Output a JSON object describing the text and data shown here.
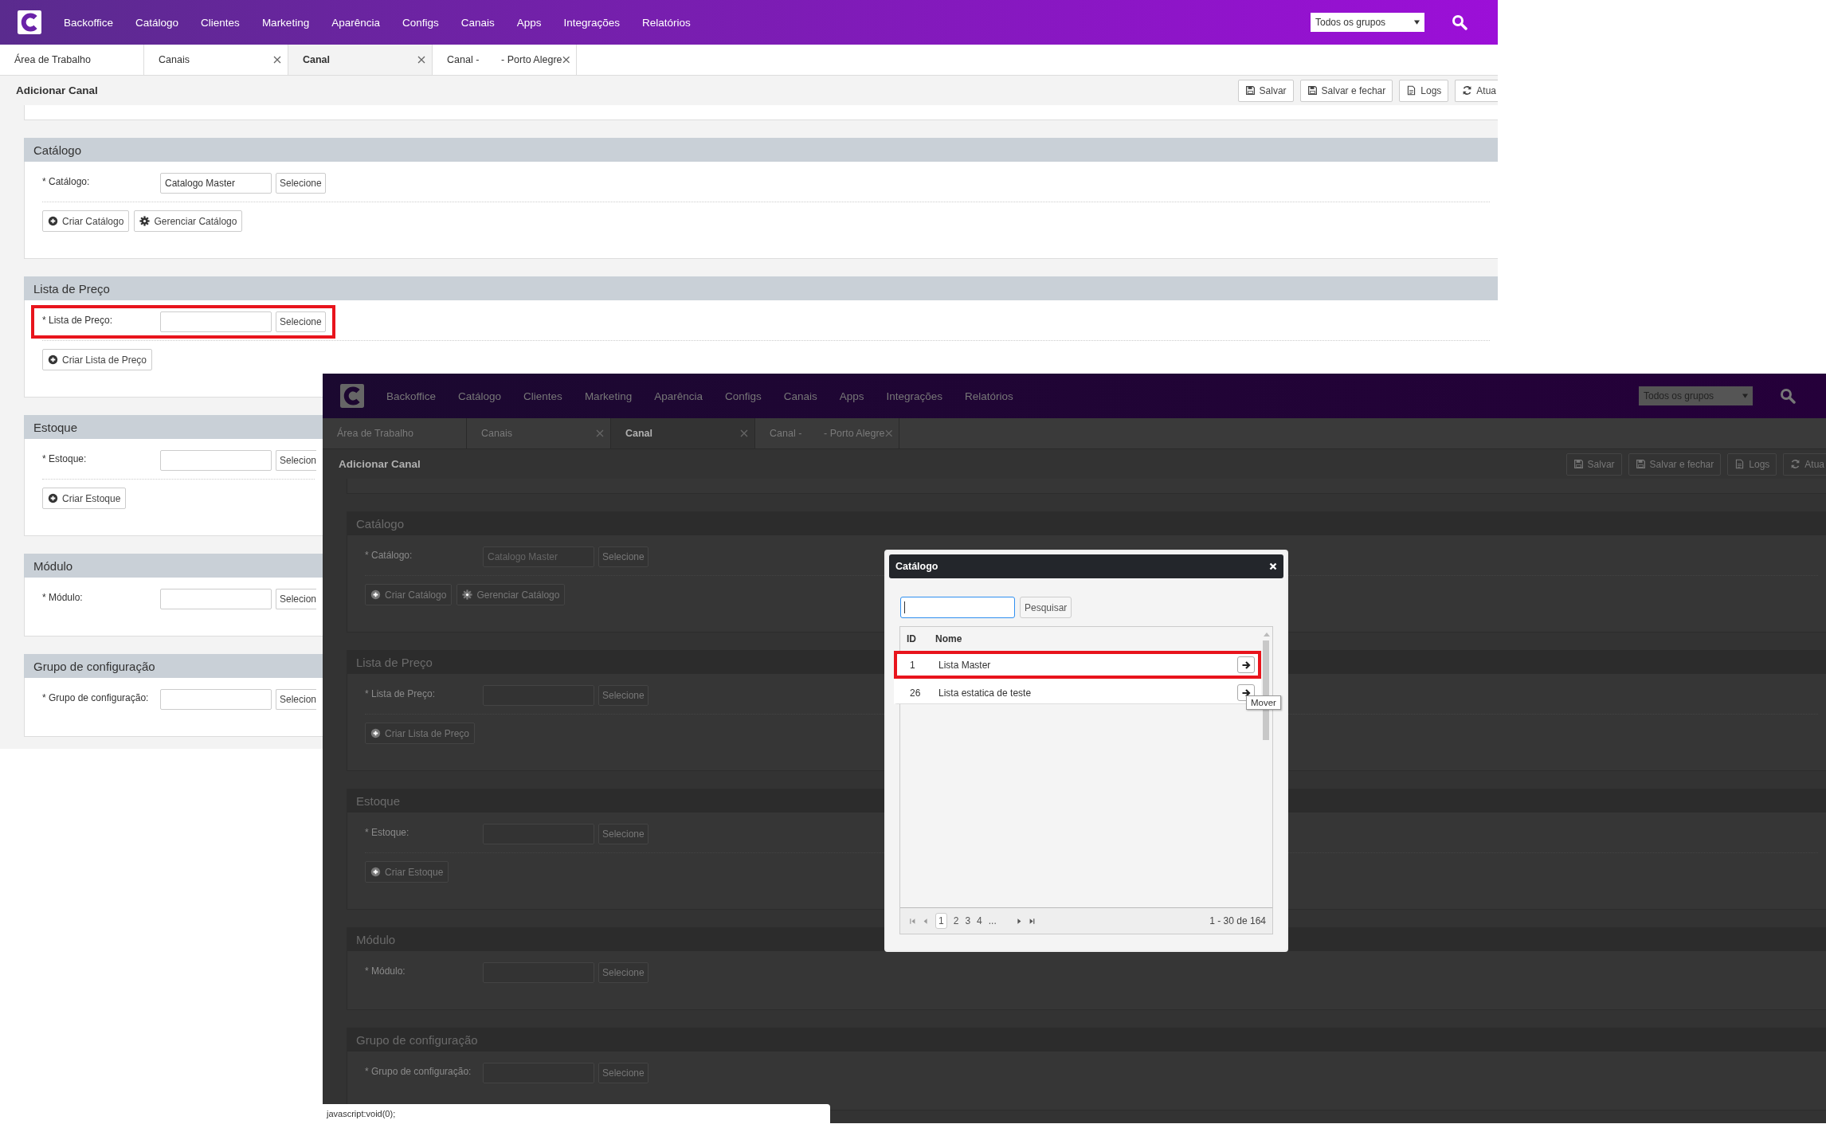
{
  "screens": [
    {
      "dimmed": false,
      "nav": {
        "items": [
          "Backoffice",
          "Catálogo",
          "Clientes",
          "Marketing",
          "Aparência",
          "Configs",
          "Canais",
          "Apps",
          "Integrações",
          "Relatórios"
        ],
        "group_select": "Todos os grupos"
      },
      "tabs": [
        {
          "label": "Área de Trabalho",
          "selected": false,
          "closable": false
        },
        {
          "label": "Canais",
          "selected": false,
          "closable": true
        },
        {
          "label": "Canal",
          "selected": true,
          "closable": true
        },
        {
          "label": "Canal -        - Porto Alegre",
          "selected": false,
          "closable": true
        }
      ],
      "page_title": "Adicionar Canal",
      "actions": [
        {
          "label": "Salvar",
          "kind": "save"
        },
        {
          "label": "Salvar e fechar",
          "kind": "save"
        },
        {
          "label": "Logs",
          "kind": "document"
        },
        {
          "label": "Atua",
          "kind": "refresh"
        }
      ],
      "sections": [
        {
          "title": "Catálogo",
          "fields": [
            {
              "label": "* Catálogo:",
              "value": "Catalogo Master",
              "button": "Selecione",
              "highlighted": false
            }
          ],
          "buttons": [
            {
              "label": "Criar Catálogo",
              "kind": "add"
            },
            {
              "label": "Gerenciar Catálogo",
              "kind": "settings"
            }
          ]
        },
        {
          "title": "Lista de Preço",
          "fields": [
            {
              "label": "* Lista de Preço:",
              "button": "Selecione",
              "highlighted": true
            }
          ],
          "buttons": [
            {
              "label": "Criar Lista de Preço",
              "kind": "add"
            }
          ]
        },
        {
          "title": "Estoque",
          "fields": [
            {
              "label": "* Estoque:",
              "button": "Selecion",
              "highlighted": false
            }
          ],
          "buttons": [
            {
              "label": "Criar Estoque",
              "kind": "add"
            }
          ]
        },
        {
          "title": "Módulo",
          "fields": [
            {
              "label": "* Módulo:",
              "button": "Selecion",
              "highlighted": false
            }
          ]
        },
        {
          "title": "Grupo de configuração",
          "fields": [
            {
              "label": "* Grupo de configuração:",
              "button": "Selecion",
              "highlighted": false
            }
          ]
        }
      ]
    },
    {
      "dimmed": true,
      "nav": {
        "items": [
          "Backoffice",
          "Catálogo",
          "Clientes",
          "Marketing",
          "Aparência",
          "Configs",
          "Canais",
          "Apps",
          "Integrações",
          "Relatórios"
        ],
        "group_select": "Todos os grupos"
      },
      "tabs": [
        {
          "label": "Área de Trabalho",
          "selected": false,
          "closable": false
        },
        {
          "label": "Canais",
          "selected": false,
          "closable": true
        },
        {
          "label": "Canal",
          "selected": true,
          "closable": true
        },
        {
          "label": "Canal -        - Porto Alegre",
          "selected": false,
          "closable": true
        }
      ],
      "page_title": "Adicionar Canal",
      "actions": [
        {
          "label": "Salvar",
          "kind": "save"
        },
        {
          "label": "Salvar e fechar",
          "kind": "save"
        },
        {
          "label": "Logs",
          "kind": "document"
        },
        {
          "label": "Atua",
          "kind": "refresh"
        }
      ],
      "sections": [
        {
          "title": "Catálogo",
          "fields": [
            {
              "label": "* Catálogo:",
              "value": "Catalogo Master",
              "button": "Selecione",
              "highlighted": false
            }
          ],
          "buttons": [
            {
              "label": "Criar Catálogo",
              "kind": "add"
            },
            {
              "label": "Gerenciar Catálogo",
              "kind": "settings"
            }
          ]
        },
        {
          "title": "Lista de Preço",
          "fields": [
            {
              "label": "* Lista de Preço:",
              "button": "Selecione",
              "highlighted": false
            }
          ],
          "buttons": [
            {
              "label": "Criar Lista de Preço",
              "kind": "add"
            }
          ]
        },
        {
          "title": "Estoque",
          "fields": [
            {
              "label": "* Estoque:",
              "button": "Selecione",
              "highlighted": false
            }
          ],
          "buttons": [
            {
              "label": "Criar Estoque",
              "kind": "add"
            }
          ]
        },
        {
          "title": "Módulo",
          "fields": [
            {
              "label": "* Módulo:",
              "button": "Selecione",
              "highlighted": false
            }
          ]
        },
        {
          "title": "Grupo de configuração",
          "fields": [
            {
              "label": "* Grupo de configuração:",
              "button": "Selecione",
              "highlighted": false
            }
          ]
        }
      ],
      "modal": {
        "title": "Catálogo",
        "search_button": "Pesquisar",
        "columns": [
          "ID",
          "Nome"
        ],
        "rows": [
          {
            "id": "1",
            "name": "Lista Master",
            "highlighted": true
          },
          {
            "id": "26",
            "name": "Lista estatica de teste",
            "highlighted": false
          }
        ],
        "tooltip": "Mover",
        "pages": [
          {
            "label": "1",
            "selected": true
          },
          {
            "label": "2",
            "selected": false
          },
          {
            "label": "3",
            "selected": false
          },
          {
            "label": "4",
            "selected": false
          },
          {
            "label": "...",
            "selected": false
          }
        ],
        "range": "1 - 30 de 164"
      }
    }
  ],
  "status_bar": "javascript:void(0);"
}
